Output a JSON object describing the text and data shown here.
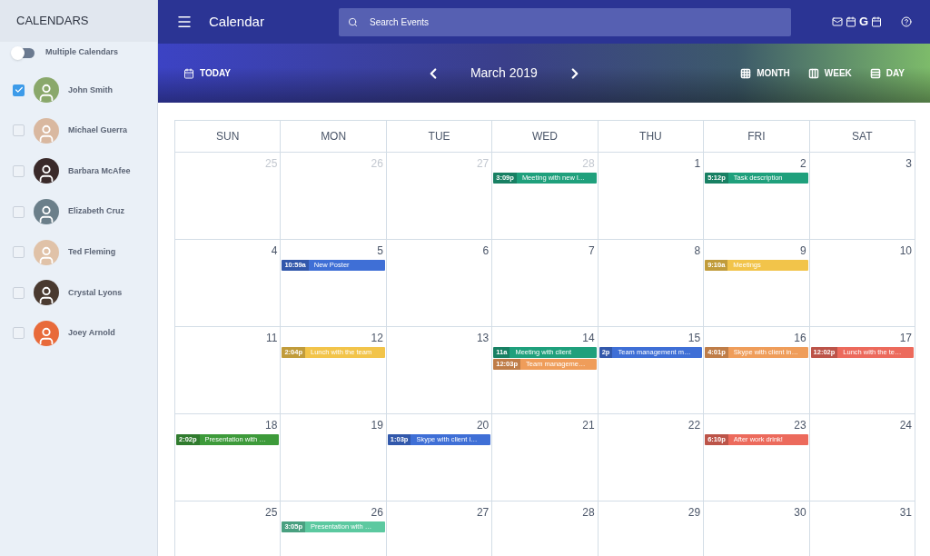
{
  "sidebar": {
    "title": "CALENDARS",
    "toggle": {
      "label": "Multiple Calendars",
      "on": false
    },
    "people": [
      {
        "name": "John Smith",
        "checked": true,
        "color": "#8aa86b"
      },
      {
        "name": "Michael Guerra",
        "checked": false,
        "color": "#d9b8a0"
      },
      {
        "name": "Barbara McAfee",
        "checked": false,
        "color": "#3a2a2a"
      },
      {
        "name": "Elizabeth Cruz",
        "checked": false,
        "color": "#6b7f8a"
      },
      {
        "name": "Ted Fleming",
        "checked": false,
        "color": "#e0c2a8"
      },
      {
        "name": "Crystal Lyons",
        "checked": false,
        "color": "#4a3a30"
      },
      {
        "name": "Joey Arnold",
        "checked": false,
        "color": "#e86a3a"
      }
    ]
  },
  "header": {
    "app_title": "Calendar",
    "search": {
      "placeholder": "Search Events"
    },
    "google_glyph": "G"
  },
  "toolbar": {
    "today": "TODAY",
    "month_title": "March 2019",
    "views": [
      {
        "label": "MONTH",
        "kind": "month"
      },
      {
        "label": "WEEK",
        "kind": "week"
      },
      {
        "label": "DAY",
        "kind": "day"
      }
    ]
  },
  "weekdays": [
    "SUN",
    "MON",
    "TUE",
    "WED",
    "THU",
    "FRI",
    "SAT"
  ],
  "weeks": [
    [
      {
        "day": "25",
        "outside": true
      },
      {
        "day": "26",
        "outside": true
      },
      {
        "day": "27",
        "outside": true
      },
      {
        "day": "28",
        "outside": true,
        "events": [
          {
            "time": "3:09p",
            "title": "Meeting with new l…",
            "color": "#1fa07c"
          }
        ]
      },
      {
        "day": "1",
        "outside": false
      },
      {
        "day": "2",
        "outside": false,
        "events": [
          {
            "time": "5:12p",
            "title": "Task description",
            "color": "#1fa07c"
          }
        ]
      },
      {
        "day": "3",
        "outside": false
      }
    ],
    [
      {
        "day": "4",
        "outside": false
      },
      {
        "day": "5",
        "outside": false,
        "events": [
          {
            "time": "10:59a",
            "title": "New Poster",
            "color": "#3f6fd6"
          }
        ]
      },
      {
        "day": "6",
        "outside": false
      },
      {
        "day": "7",
        "outside": false
      },
      {
        "day": "8",
        "outside": false
      },
      {
        "day": "9",
        "outside": false,
        "events": [
          {
            "time": "9:10a",
            "title": "Meetings",
            "color": "#f2c44a"
          }
        ]
      },
      {
        "day": "10",
        "outside": false
      }
    ],
    [
      {
        "day": "11",
        "outside": false
      },
      {
        "day": "12",
        "outside": false,
        "events": [
          {
            "time": "2:04p",
            "title": "Lunch with the team",
            "color": "#f2c44a"
          }
        ]
      },
      {
        "day": "13",
        "outside": false
      },
      {
        "day": "14",
        "outside": false,
        "events": [
          {
            "time": "11a",
            "title": "Meeting with client",
            "color": "#1fa07c"
          },
          {
            "time": "12:03p",
            "title": "Team manageme…",
            "color": "#ef9d5a"
          }
        ]
      },
      {
        "day": "15",
        "outside": false,
        "events": [
          {
            "time": "2p",
            "title": "Team management m…",
            "color": "#3f6fd6"
          }
        ]
      },
      {
        "day": "16",
        "outside": false,
        "events": [
          {
            "time": "4:01p",
            "title": "Skype with client in…",
            "color": "#ef9d5a"
          }
        ]
      },
      {
        "day": "17",
        "outside": false,
        "events": [
          {
            "time": "12:02p",
            "title": "Lunch with the te…",
            "color": "#ec6a5c"
          }
        ]
      }
    ],
    [
      {
        "day": "18",
        "outside": false,
        "events": [
          {
            "time": "2:02p",
            "title": "Presentation with …",
            "color": "#3d9a3a"
          }
        ]
      },
      {
        "day": "19",
        "outside": false
      },
      {
        "day": "20",
        "outside": false,
        "events": [
          {
            "time": "1:03p",
            "title": "Skype with client i…",
            "color": "#3f6fd6"
          }
        ]
      },
      {
        "day": "21",
        "outside": false
      },
      {
        "day": "22",
        "outside": false
      },
      {
        "day": "23",
        "outside": false,
        "events": [
          {
            "time": "6:10p",
            "title": "After work drink!",
            "color": "#ec6a5c"
          }
        ]
      },
      {
        "day": "24",
        "outside": false
      }
    ],
    [
      {
        "day": "25",
        "outside": false
      },
      {
        "day": "26",
        "outside": false,
        "events": [
          {
            "time": "3:05p",
            "title": "Presentation with …",
            "color": "#5cc9a0"
          }
        ]
      },
      {
        "day": "27",
        "outside": false
      },
      {
        "day": "28",
        "outside": false
      },
      {
        "day": "29",
        "outside": false
      },
      {
        "day": "30",
        "outside": false
      },
      {
        "day": "31",
        "outside": false
      }
    ]
  ]
}
